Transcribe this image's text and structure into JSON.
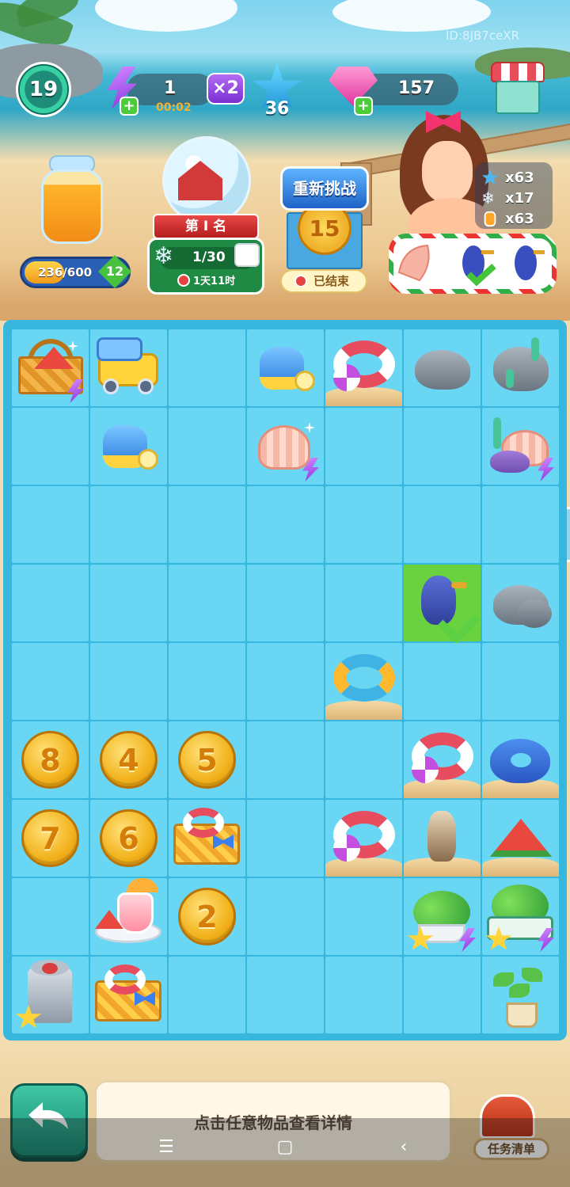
{
  "watermark": "ID:8JB7ceXR",
  "hud": {
    "level": "19",
    "energy_value": "1",
    "energy_timer": "00:02",
    "energy_multiplier": "×2",
    "stars": "36",
    "gems": "157"
  },
  "jar": {
    "progress_text": "236/600",
    "progress_fraction": 0.393,
    "level": "12"
  },
  "event": {
    "rank_label": "第 I 名",
    "progress_text": "1/30",
    "time_left": "1天11时"
  },
  "challenge": {
    "button_label": "重新挑战",
    "coin_value": "15",
    "status": "已结束"
  },
  "character_stats": [
    {
      "icon": "blue-star-icon",
      "value": "x63"
    },
    {
      "icon": "snowflake-icon",
      "value": "x17"
    },
    {
      "icon": "juice-icon",
      "value": "x63"
    }
  ],
  "order": {
    "items": [
      "shell-icon",
      "bird-icon",
      "bird-icon"
    ],
    "completed": [
      false,
      true,
      false
    ]
  },
  "board": {
    "rows": 9,
    "cols": 7,
    "cells": [
      [
        "picnic-basket",
        "sand-truck",
        "",
        "watering-can",
        "swim-ring",
        "rock",
        "rock-coral"
      ],
      [
        "",
        "watering-can",
        "",
        "seashell",
        "",
        "",
        "coral-shell"
      ],
      [
        "",
        "",
        "",
        "",
        "",
        "",
        ""
      ],
      [
        "",
        "",
        "",
        "",
        "",
        "bird-done",
        "rocks"
      ],
      [
        "",
        "",
        "",
        "",
        "donut-ring",
        "",
        ""
      ],
      [
        "coin-8",
        "coin-4",
        "coin-5",
        "",
        "",
        "swim-ring",
        "whale-ring"
      ],
      [
        "coin-7",
        "coin-6",
        "ring-basket",
        "",
        "swim-ring",
        "pelican",
        "watermelon"
      ],
      [
        "",
        "juice-tray",
        "coin-2",
        "",
        "",
        "bush-pot",
        "bush-planter"
      ],
      [
        "juicer",
        "ring-basket",
        "",
        "",
        "",
        "",
        "potted-plant"
      ]
    ]
  },
  "bottom": {
    "info_text": "点击任意物品查看详情",
    "task_label": "任务清单"
  },
  "navbar": {
    "menu": "☰",
    "home": "▢",
    "back": "‹"
  }
}
